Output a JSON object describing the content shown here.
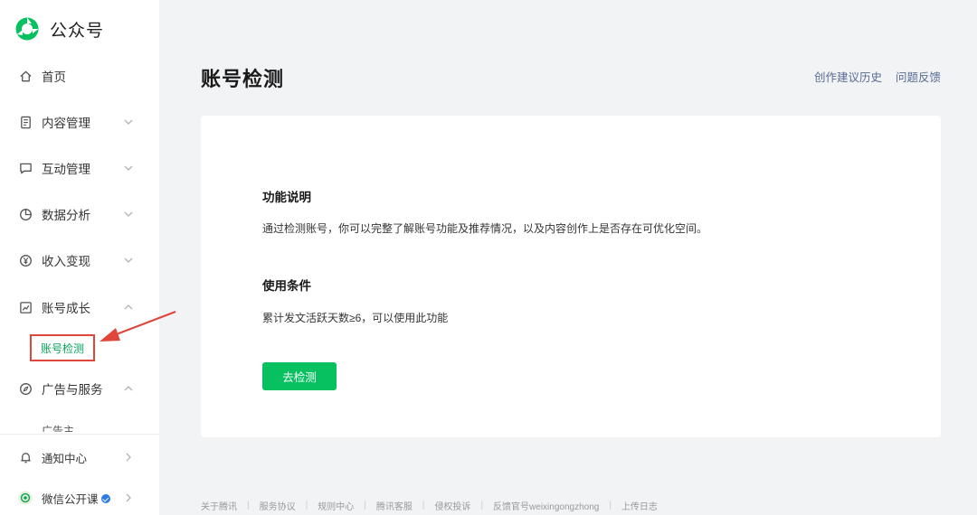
{
  "brand": {
    "name": "公众号"
  },
  "sidebar": {
    "items": [
      {
        "label": "首页",
        "icon": "home-icon"
      },
      {
        "label": "内容管理",
        "icon": "document-icon"
      },
      {
        "label": "互动管理",
        "icon": "chat-icon"
      },
      {
        "label": "数据分析",
        "icon": "pie-chart-icon"
      },
      {
        "label": "收入变现",
        "icon": "yuan-icon"
      },
      {
        "label": "账号成长",
        "icon": "growth-chart-icon"
      },
      {
        "label": "广告与服务",
        "icon": "compass-icon"
      },
      {
        "label": "通知中心",
        "icon": "bell-icon"
      },
      {
        "label": "微信公开课",
        "icon": "wechat-course-icon"
      }
    ],
    "sub_item": "账号检测",
    "sub_item_partial": "广告主"
  },
  "main": {
    "title": "账号检测",
    "links": [
      "创作建议历史",
      "问题反馈"
    ],
    "sections": [
      {
        "title": "功能说明",
        "text": "通过检测账号，你可以完整了解账号功能及推荐情况，以及内容创作上是否存在可优化空间。"
      },
      {
        "title": "使用条件",
        "text": "累计发文活跃天数≥6，可以使用此功能"
      }
    ],
    "button": "去检测"
  },
  "footer": {
    "links": [
      "关于腾讯",
      "服务协议",
      "规则中心",
      "腾讯客服",
      "侵权投诉",
      "反馈官号weixingongzhong",
      "上传日志"
    ]
  },
  "colors": {
    "accent": "#07c160",
    "link": "#576b95",
    "annotation": "#e0453a",
    "active_text": "#07a35a"
  }
}
